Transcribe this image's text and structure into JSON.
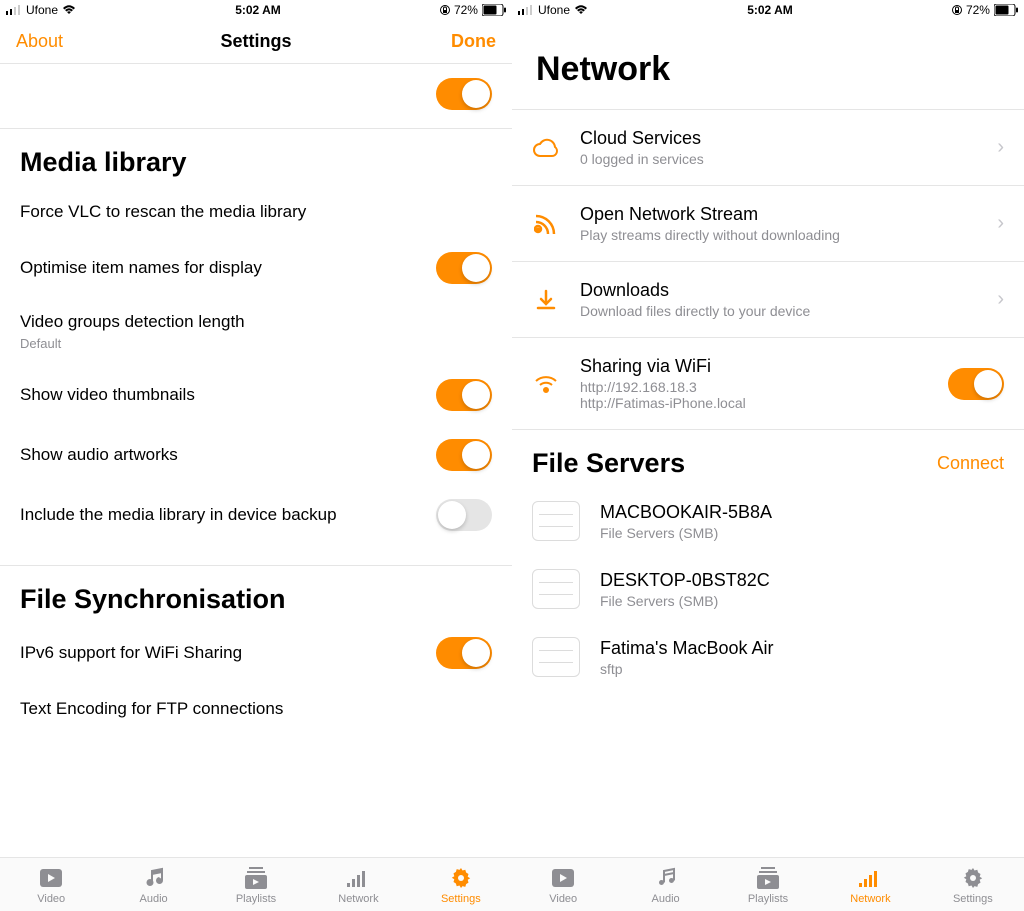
{
  "statusBar": {
    "carrier": "Ufone",
    "time": "5:02 AM",
    "battery": "72%"
  },
  "left": {
    "nav": {
      "about": "About",
      "title": "Settings",
      "done": "Done"
    },
    "sections": {
      "mediaLibrary": {
        "title": "Media library",
        "forceRescan": "Force VLC to rescan the media library",
        "optimiseNames": "Optimise item names for display",
        "videoGroups": "Video groups detection length",
        "videoGroupsSub": "Default",
        "showThumbs": "Show video thumbnails",
        "showArtworks": "Show audio artworks",
        "includeBackup": "Include the media library in device backup"
      },
      "fileSync": {
        "title": "File Synchronisation",
        "ipv6": "IPv6 support for WiFi Sharing",
        "textEncoding": "Text Encoding for FTP connections"
      }
    },
    "tabs": {
      "video": "Video",
      "audio": "Audio",
      "playlists": "Playlists",
      "network": "Network",
      "settings": "Settings",
      "active": "settings"
    }
  },
  "right": {
    "header": "Network",
    "items": {
      "cloud": {
        "title": "Cloud Services",
        "sub": "0 logged in services"
      },
      "openStream": {
        "title": "Open Network Stream",
        "sub": "Play streams directly without downloading"
      },
      "downloads": {
        "title": "Downloads",
        "sub": "Download files directly to your device"
      },
      "wifiShare": {
        "title": "Sharing via WiFi",
        "line1": "http://192.168.18.3",
        "line2": "http://Fatimas-iPhone.local"
      }
    },
    "fileServers": {
      "title": "File Servers",
      "connect": "Connect",
      "servers": [
        {
          "name": "MACBOOKAIR-5B8A",
          "type": "File Servers (SMB)"
        },
        {
          "name": "DESKTOP-0BST82C",
          "type": "File Servers (SMB)"
        },
        {
          "name": "Fatima's MacBook Air",
          "type": "sftp"
        }
      ]
    },
    "tabs": {
      "video": "Video",
      "audio": "Audio",
      "playlists": "Playlists",
      "network": "Network",
      "settings": "Settings",
      "active": "network"
    }
  }
}
